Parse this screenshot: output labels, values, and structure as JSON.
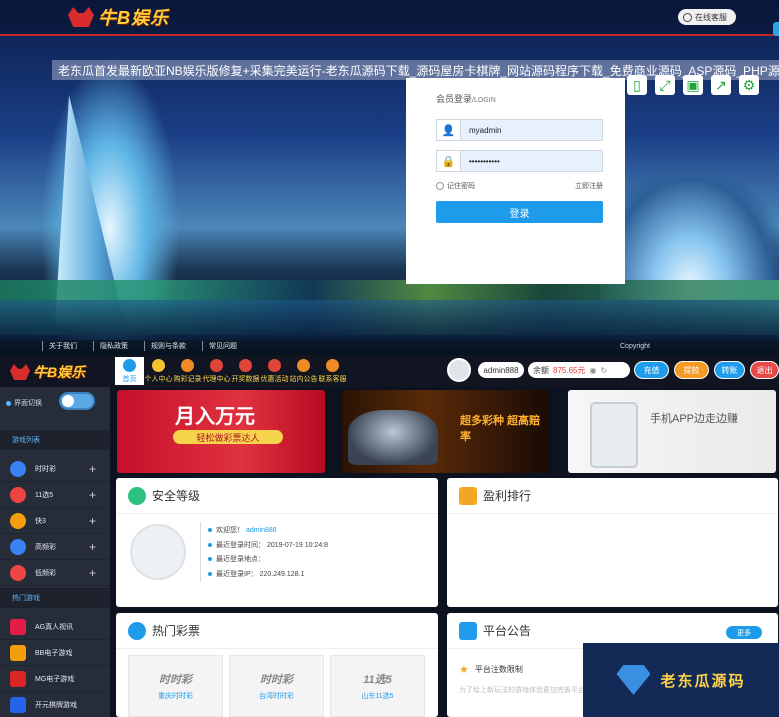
{
  "hero": {
    "logo_text": "牛B娱乐",
    "service_label": "在线客服",
    "watermark_title": "老东瓜首发最新欧亚NB娱乐版修复+采集完美运行-老东瓜源码下载_源码屋房卡棋牌_网站源码程序下载_免费商业源码_ASP源码_PHP源码",
    "footer_links": [
      "关于我们",
      "隐私政策",
      "规则与条款",
      "常见问题"
    ],
    "copyright": "Copyright"
  },
  "login": {
    "title": "会员登录",
    "title_suffix": "/LOGIN",
    "username": "myadmin",
    "password": "•••••••••••",
    "remember": "记住密码",
    "register": "立即注册",
    "submit": "登录"
  },
  "nav": {
    "logo_text": "牛B娱乐",
    "items": [
      {
        "label": "首页",
        "color": "#1e9ceb"
      },
      {
        "label": "个人中心",
        "color": "#f2c230"
      },
      {
        "label": "购彩记录",
        "color": "#f08a24"
      },
      {
        "label": "代理中心",
        "color": "#e0453a"
      },
      {
        "label": "开奖数据",
        "color": "#e0453a"
      },
      {
        "label": "优惠活动",
        "color": "#e0453a"
      },
      {
        "label": "站内公告",
        "color": "#f08a24"
      },
      {
        "label": "联系客服",
        "color": "#f08a24"
      }
    ],
    "username": "admin888",
    "balance_label": "余额",
    "balance": "875.65元",
    "buttons": [
      {
        "label": "充值",
        "color": "#1e9ceb"
      },
      {
        "label": "提款",
        "color": "#f59a23"
      },
      {
        "label": "转账",
        "color": "#1e9ceb"
      },
      {
        "label": "退出",
        "color": "#e84a4a"
      }
    ]
  },
  "sidebar": {
    "switch_label": "界面切换",
    "section_games": "游戏列表",
    "games": [
      {
        "label": "时时彩",
        "color": "#3b82f6"
      },
      {
        "label": "11选5",
        "color": "#ef4444"
      },
      {
        "label": "快3",
        "color": "#f59e0b"
      },
      {
        "label": "高频彩",
        "color": "#3b82f6"
      },
      {
        "label": "低频彩",
        "color": "#ef4444"
      }
    ],
    "section_hot": "热门游戏",
    "hot": [
      {
        "label": "AG真人视讯",
        "color": "#e11d48"
      },
      {
        "label": "BB电子游戏",
        "color": "#f59e0b"
      },
      {
        "label": "MG电子游戏",
        "color": "#dc2626"
      },
      {
        "label": "开元棋牌游戏",
        "color": "#2563eb"
      }
    ]
  },
  "banners": {
    "b1_title": "月入万元",
    "b1_sub": "轻松做彩票达人",
    "b2_title": "超多彩种 超高赔率",
    "b3_title": "手机APP边走边赚"
  },
  "security": {
    "title": "安全等级",
    "welcome": "欢迎您！",
    "user": "admin888",
    "last_login_label": "最近登录时间：",
    "last_login": "2019-07-19 10:24:8",
    "last_place_label": "最近登录地点：",
    "last_ip_label": "最近登录IP：",
    "last_ip": "220.249.128.1"
  },
  "ranking": {
    "title": "盈利排行"
  },
  "hot_lottery": {
    "title": "热门彩票",
    "items": [
      {
        "logo": "时时彩",
        "name": "重庆时时彩"
      },
      {
        "logo": "时时彩",
        "name": "台湾时时彩"
      },
      {
        "logo": "11选5",
        "name": "山东11选5"
      }
    ]
  },
  "notice": {
    "title": "平台公告",
    "more": "更多",
    "item1": "平台注数限制",
    "item2": "为了给上新玩法的游戏体验更加完善平台..."
  },
  "watermark": {
    "text": "老东瓜源码"
  }
}
